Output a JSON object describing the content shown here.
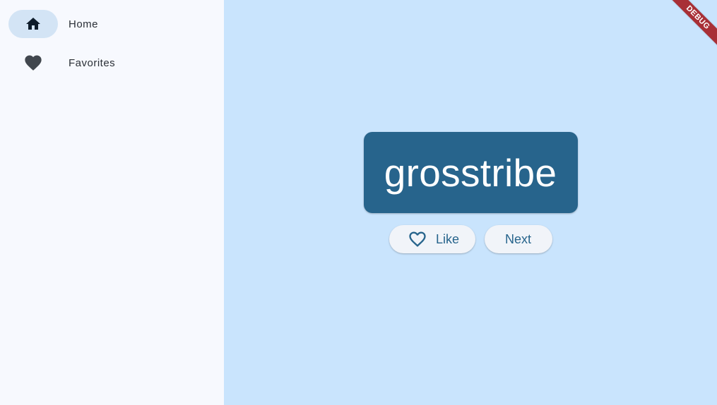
{
  "navigation": {
    "items": [
      {
        "label": "Home",
        "icon": "home-icon",
        "selected": true
      },
      {
        "label": "Favorites",
        "icon": "heart-icon",
        "selected": false
      }
    ]
  },
  "main": {
    "word": "grosstribe",
    "like_label": "Like",
    "next_label": "Next"
  },
  "debug_banner": "DEBUG",
  "colors": {
    "rail_background": "#f7f9fe",
    "indicator": "#d3e4f5",
    "main_background": "#c9e4fd",
    "card": "#27648c",
    "button_background": "#f1f4f9",
    "debug_ribbon": "#a82f36"
  }
}
